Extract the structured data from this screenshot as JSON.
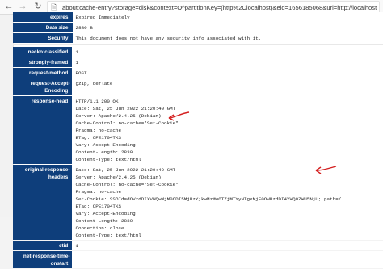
{
  "toolbar": {
    "url": "about:cache-entry?storage=disk&context=O^partitionKey=(http%2Clocalhost)&eid=1656185068&uri=http://localhost"
  },
  "entry_summary": [
    {
      "key": "expires:",
      "value": "Expired Immediately"
    },
    {
      "key": "Data size:",
      "value": "2830 B"
    },
    {
      "key": "Security:",
      "value": "This document does not have any security info associated with it."
    }
  ],
  "metadata": [
    {
      "key": "necko:classified:",
      "lines": [
        "1"
      ]
    },
    {
      "key": "strongly-framed:",
      "lines": [
        "1"
      ]
    },
    {
      "key": "request-method:",
      "lines": [
        "POST"
      ]
    },
    {
      "key": "request-Accept-Encoding:",
      "lines": [
        "gzip, deflate"
      ]
    },
    {
      "key": "response-head:",
      "lines": [
        "HTTP/1.1 200 OK",
        "Date: Sat, 25 Jun 2022 21:20:40 GMT",
        "Server: Apache/2.4.25 (Debian)",
        "Cache-Control: no-cache=\"Set-Cookie\"",
        "Pragma: no-cache",
        "ETag: CPE1704TKS",
        "Vary: Accept-Encoding",
        "Content-Length: 2830",
        "Content-Type: text/html"
      ]
    },
    {
      "key": "original-response-headers:",
      "lines": [
        "Date: Sat, 25 Jun 2022 21:20:40 GMT",
        "Server: Apache/2.4.25 (Debian)",
        "Cache-Control: no-cache=\"Set-Cookie\"",
        "Pragma: no-cache",
        "Set-Cookie: SSOId=dOVzdDIXVWQwMjM0ODI5MjUzYjkwMzMwOTZjMTYyNTgxMjE0OWUzdDI4YWQ0ZWU5NjU; path=/",
        "ETag: CPE1704TKS",
        "Vary: Accept-Encoding",
        "Content-Length: 2830",
        "Connection: close",
        "Content-Type: text/html"
      ]
    },
    {
      "key": "ctid:",
      "lines": [
        "1"
      ]
    },
    {
      "key": "net-response-time-onstart:",
      "lines": [
        ""
      ]
    }
  ],
  "icons": {
    "back": "back-arrow-icon",
    "forward": "forward-arrow-icon",
    "reload": "reload-icon",
    "page": "page-info-icon",
    "annotation": "red-arrow-annotation-icon"
  },
  "colors": {
    "key_bg": "#0e3e7b",
    "annotation": "#d42020"
  }
}
